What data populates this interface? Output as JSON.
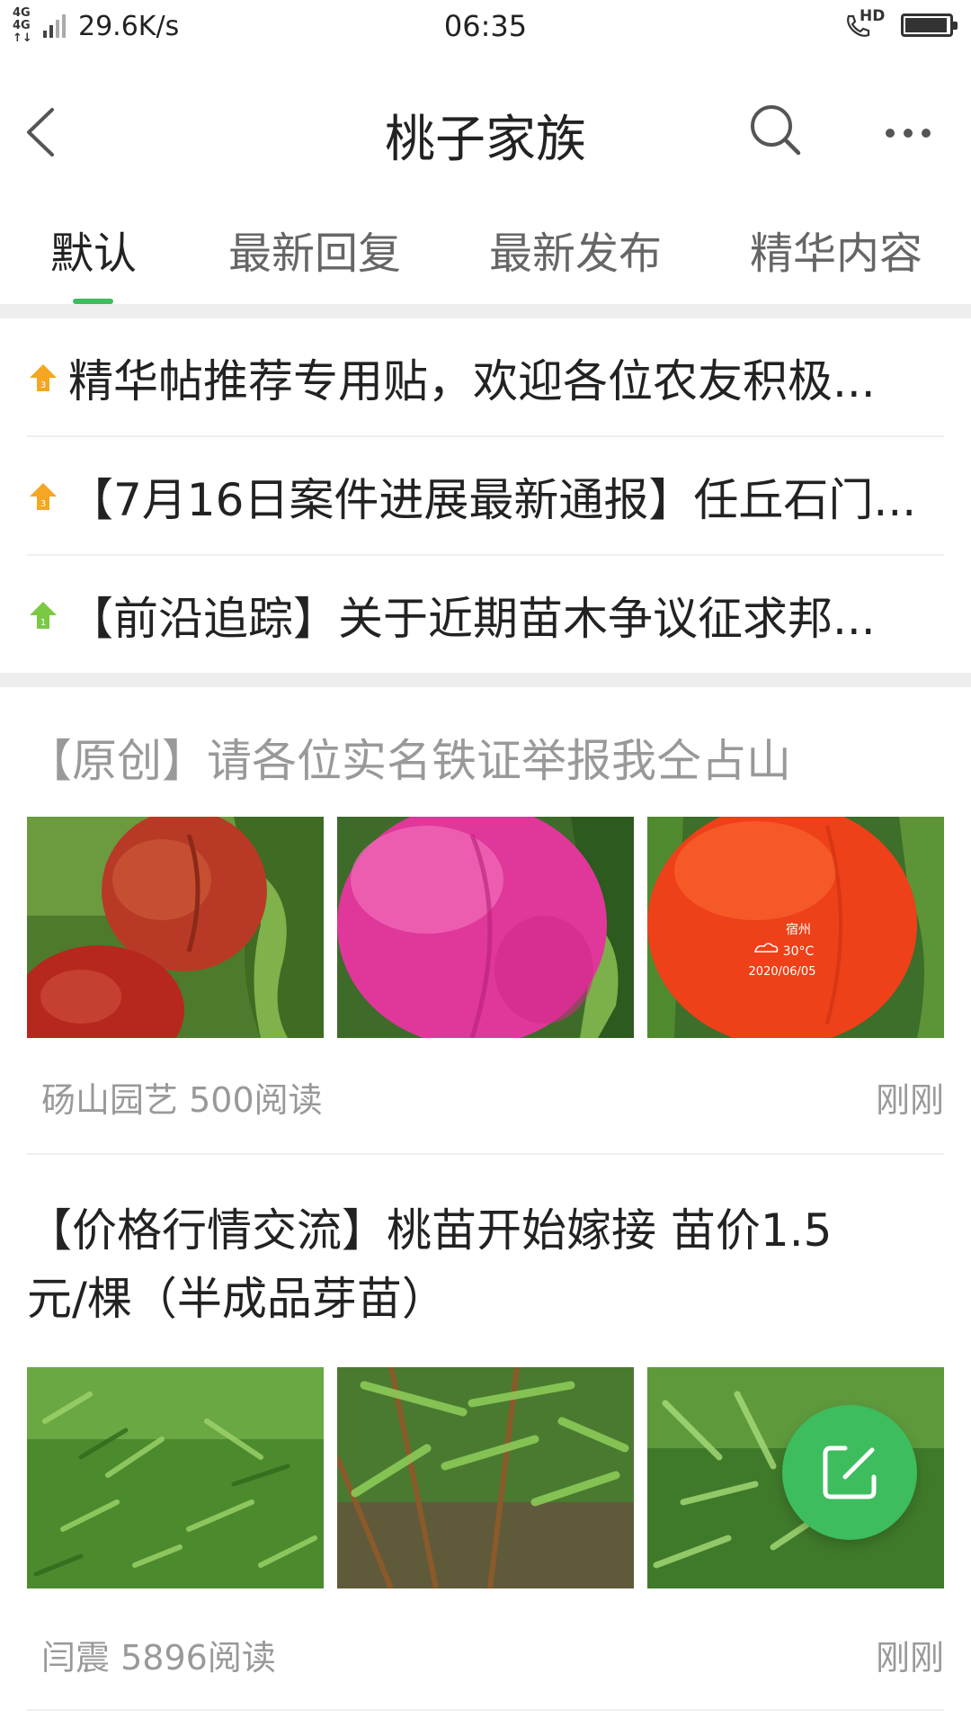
{
  "status_bar": {
    "network_label_top": "4G 4G",
    "network_label_bottom": "↑↓",
    "net_speed": "29.6K/s",
    "time": "06:35",
    "call_badge": "HD"
  },
  "header": {
    "title": "桃子家族",
    "back_icon": "back-chevron-icon",
    "search_icon": "search-icon",
    "more_icon": "more-dots-icon"
  },
  "tabs": [
    {
      "label": "默认",
      "active": true
    },
    {
      "label": "最新回复",
      "active": false
    },
    {
      "label": "最新发布",
      "active": false
    },
    {
      "label": "精华内容",
      "active": false
    }
  ],
  "sticky_posts": [
    {
      "title": "精华帖推荐专用贴，欢迎各位农友积极...",
      "pin_color": "#f5a623",
      "pin_number": "3"
    },
    {
      "title": "【7月16日案件进展最新通报】任丘石门...",
      "pin_color": "#f5a623",
      "pin_number": "3"
    },
    {
      "title": "【前沿追踪】关于近期苗木争议征求邦...",
      "pin_color": "#7ac943",
      "pin_number": "1"
    }
  ],
  "posts": [
    {
      "title": "【原创】请各位实名铁证举报我仝占山",
      "title_color": "#999999",
      "author": "砀山园艺",
      "reads": "500阅读",
      "time": "刚刚",
      "watermark": {
        "city": "宿州",
        "temp": "30°C",
        "date": "2020/06/05"
      }
    },
    {
      "title_line1": "【价格行情交流】桃苗开始嫁接 苗价1.5",
      "title_line2": "元/棵（半成品芽苗）",
      "title_color": "#222222",
      "author": "闫震",
      "reads": "5896阅读",
      "time": "刚刚"
    }
  ],
  "fab": {
    "icon": "compose-edit-icon",
    "color": "#3dbd5d"
  },
  "colors": {
    "accent": "#3dbd5d",
    "meta_text": "#999999",
    "divider": "#eeeeee"
  }
}
